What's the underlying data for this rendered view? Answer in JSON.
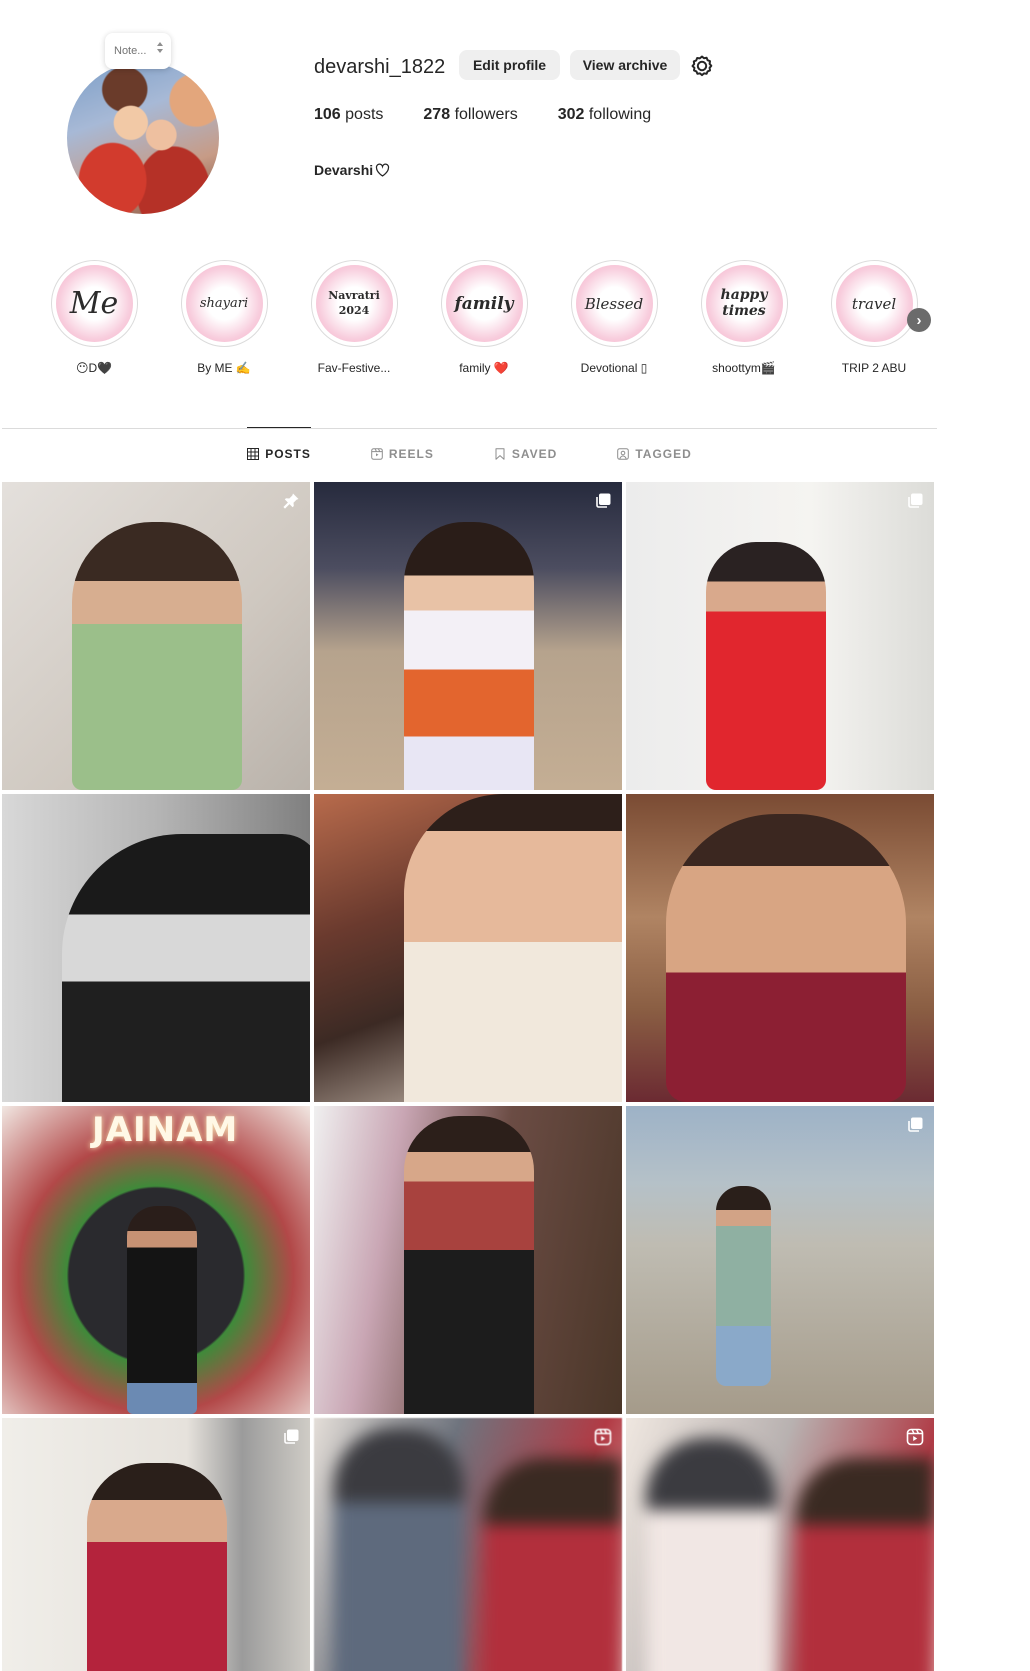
{
  "profile": {
    "note_placeholder": "Note...",
    "username": "devarshi_1822",
    "edit_profile_label": "Edit profile",
    "view_archive_label": "View archive",
    "posts_count": "106",
    "posts_label": "posts",
    "followers_count": "278",
    "followers_label": "followers",
    "following_count": "302",
    "following_label": "following",
    "full_name": "Devarshi"
  },
  "highlights": [
    {
      "cover": "Me",
      "label": "😶D🖤"
    },
    {
      "cover": "shayari",
      "label": "By ME ✍️"
    },
    {
      "cover": "Navratri 2024",
      "label": "Fav-Festive..."
    },
    {
      "cover": "family",
      "label": "family ❤️"
    },
    {
      "cover": "Blessed",
      "label": "Devotional ▯"
    },
    {
      "cover": "happy times",
      "label": "shoottym🎬"
    },
    {
      "cover": "travel",
      "label": "TRIP 2 ABU"
    }
  ],
  "tabs": [
    {
      "label": "POSTS",
      "icon": "grid-icon",
      "active": true
    },
    {
      "label": "REELS",
      "icon": "reels-icon",
      "active": false
    },
    {
      "label": "SAVED",
      "icon": "bookmark-icon",
      "active": false
    },
    {
      "label": "TAGGED",
      "icon": "tagged-icon",
      "active": false
    }
  ],
  "posts": [
    {
      "badge": "pin-icon"
    },
    {
      "badge": "carousel-icon"
    },
    {
      "badge": "carousel-icon"
    },
    {
      "badge": ""
    },
    {
      "badge": ""
    },
    {
      "badge": ""
    },
    {
      "badge": "",
      "text": "JAINAM"
    },
    {
      "badge": ""
    },
    {
      "badge": "carousel-icon"
    },
    {
      "badge": "carousel-icon"
    },
    {
      "badge": "reel-icon"
    },
    {
      "badge": "reel-icon"
    }
  ],
  "colors": {
    "text": "#262626",
    "secondary": "#8e8e8e",
    "button_bg": "#efefef",
    "divider": "#dbdbdb",
    "highlight_pink": "#f3a9c4"
  }
}
